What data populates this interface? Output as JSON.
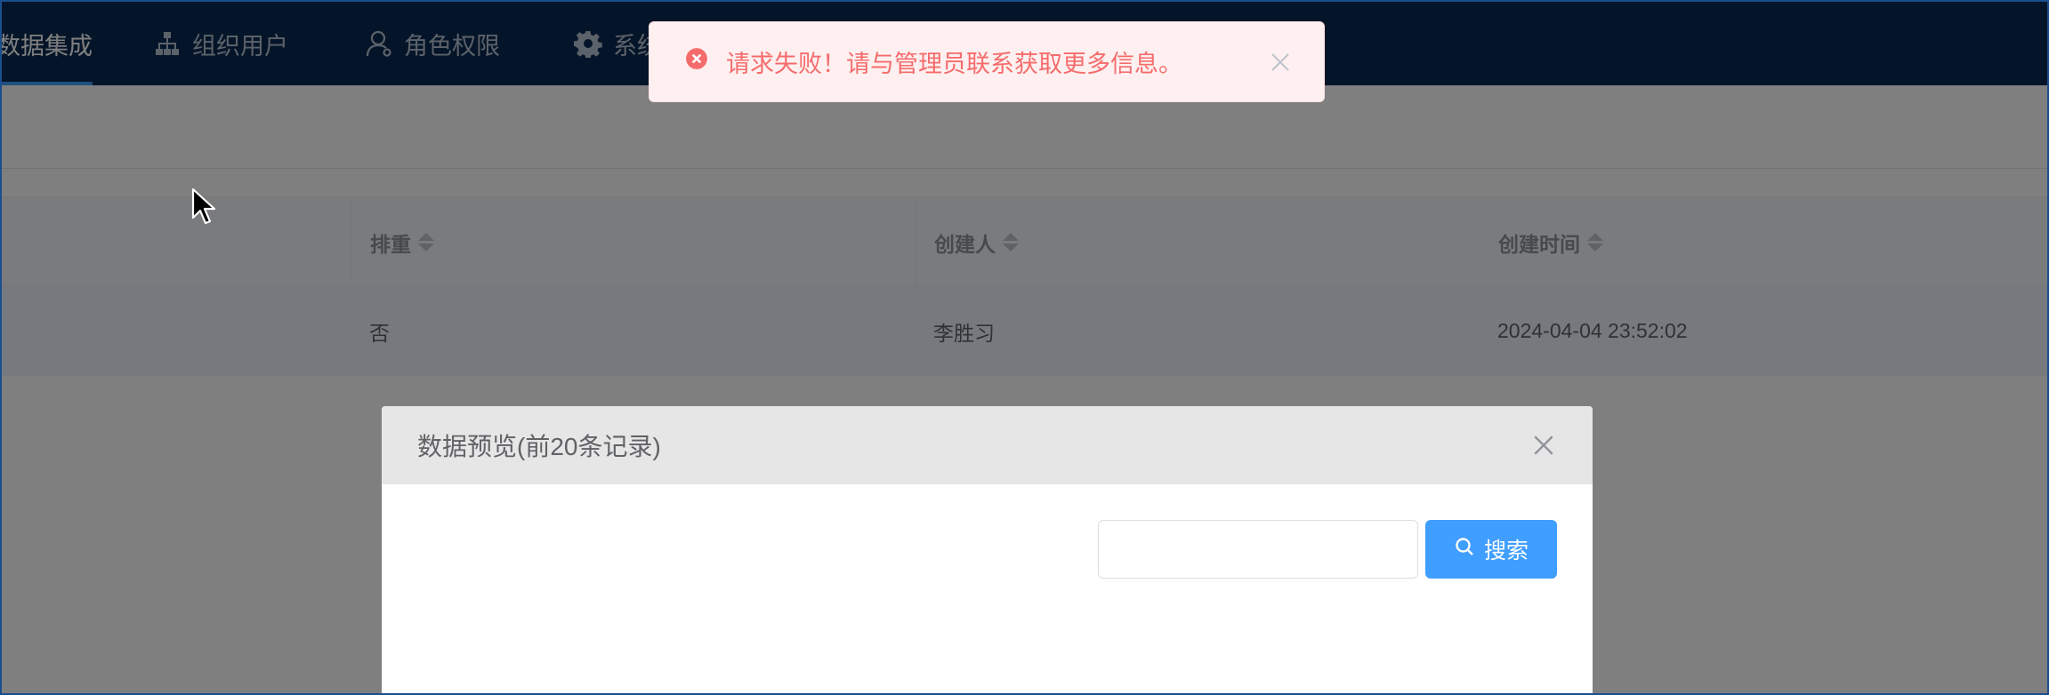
{
  "nav": {
    "items": [
      {
        "label": "数据集成",
        "icon": "data-icon",
        "active": true
      },
      {
        "label": "组织用户",
        "icon": "org-tree-icon",
        "active": false
      },
      {
        "label": "角色权限",
        "icon": "user-role-icon",
        "active": false
      },
      {
        "label": "系统",
        "icon": "gear-icon",
        "active": false
      }
    ]
  },
  "table": {
    "columns": [
      {
        "label": "排重"
      },
      {
        "label": "创建人"
      },
      {
        "label": "创建时间"
      }
    ],
    "rows": [
      {
        "dedup": "否",
        "creator": "李胜习",
        "created_at": "2024-04-04 23:52:02"
      }
    ]
  },
  "dialog": {
    "title": "数据预览(前20条记录)",
    "search": {
      "value": "",
      "placeholder": ""
    },
    "search_button_label": "搜索"
  },
  "toast": {
    "type": "error",
    "message": "请求失败！请与管理员联系获取更多信息。"
  },
  "colors": {
    "nav_bg": "#0a2a52",
    "primary": "#409eff",
    "error": "#f56c6c",
    "error_bg": "#fef0f0"
  }
}
